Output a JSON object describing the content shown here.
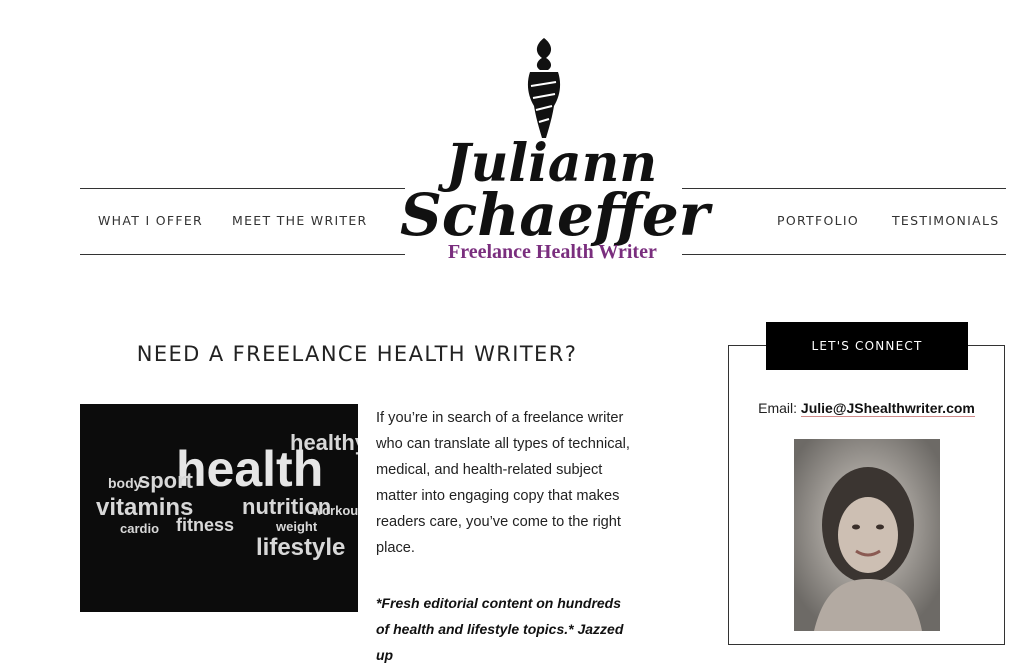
{
  "nav": {
    "left": [
      "WHAT I OFFER",
      "MEET THE WRITER"
    ],
    "right": [
      "PORTFOLIO",
      "TESTIMONIALS"
    ]
  },
  "logo": {
    "first_name": "Juliann",
    "last_name": "Schaeffer",
    "tagline": "Freelance Health Writer",
    "tagline_color": "#7a2e7e"
  },
  "main": {
    "title": "NEED A FREELANCE HEALTH WRITER?",
    "image_words": [
      "health",
      "healthy",
      "sport",
      "vitamins",
      "fitness",
      "nutrition",
      "lifestyle",
      "body",
      "cardio",
      "workout",
      "weight"
    ],
    "intro": "If you’re in search of a freelance writer who can translate all types of technical, medical, and health-related subject matter into engaging copy that makes readers care, you’ve come to the right place.",
    "teaser": "*Fresh editorial content on hundreds of health and lifestyle topics.* Jazzed up"
  },
  "sidebar": {
    "connect_title": "LET'S CONNECT",
    "email_label": "Email:",
    "email": "Julie@JShealthwriter.com"
  },
  "colors": {
    "accent": "#000000",
    "link_underline": "#d08a8a"
  }
}
